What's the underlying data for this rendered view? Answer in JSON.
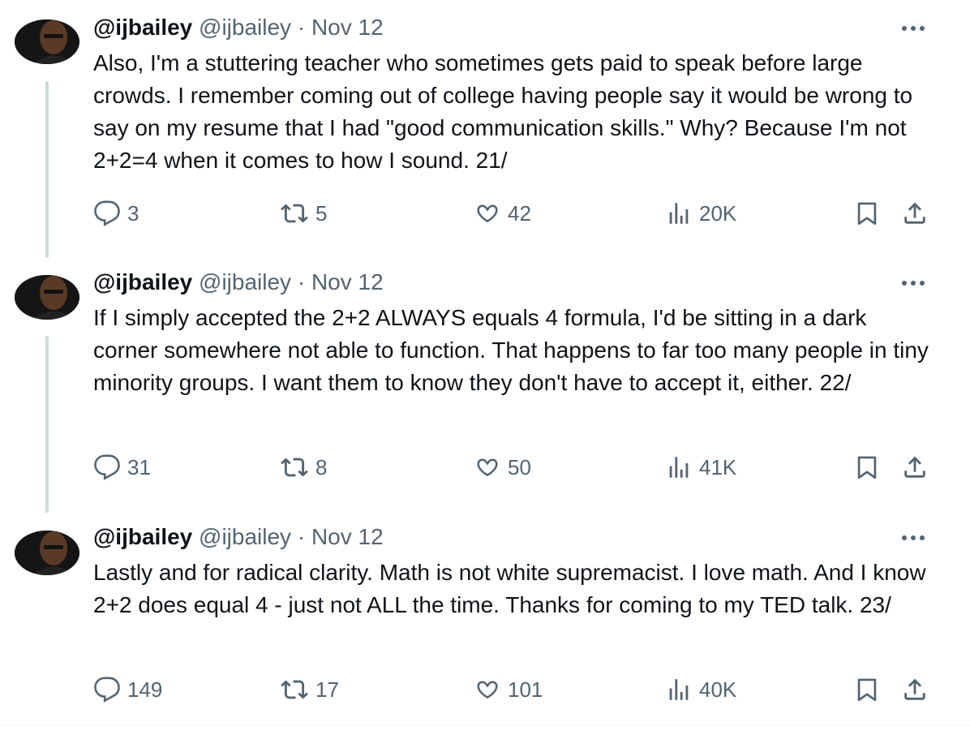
{
  "tweets": [
    {
      "name": "@ijbailey",
      "handle": "@ijbailey",
      "separator": "·",
      "date": "Nov 12",
      "text": "Also, I'm a stuttering teacher who sometimes gets paid to speak before large crowds. I remember coming out of college having people say it would be wrong to say on my resume that I had \"good communication skills.\" Why? Because I'm not 2+2=4 when it comes to how I sound. 21/",
      "replies": "3",
      "reposts": "5",
      "likes": "42",
      "views": "20K"
    },
    {
      "name": "@ijbailey",
      "handle": "@ijbailey",
      "separator": "·",
      "date": "Nov 12",
      "text": "If I simply accepted the 2+2 ALWAYS equals 4 formula, I'd be sitting in a dark corner somewhere not able to function. That happens to far too many people in tiny minority groups. I want them to know they don't have to accept it, either. 22/",
      "replies": "31",
      "reposts": "8",
      "likes": "50",
      "views": "41K"
    },
    {
      "name": "@ijbailey",
      "handle": "@ijbailey",
      "separator": "·",
      "date": "Nov 12",
      "text": "Lastly and for radical clarity. Math is not white supremacist. I love math. And I know 2+2 does equal 4 - just not ALL the time. Thanks for coming to my TED talk. 23/",
      "replies": "149",
      "reposts": "17",
      "likes": "101",
      "views": "40K"
    }
  ],
  "icons": {
    "more": "more-horizontal-icon",
    "reply": "speech-bubble-icon",
    "repost": "repost-arrows-icon",
    "like": "heart-icon",
    "views": "bar-chart-icon",
    "bookmark": "bookmark-icon",
    "share": "share-upload-icon"
  },
  "colors": {
    "text": "#0f1419",
    "secondary": "#536471",
    "thread_line": "#cfd9de"
  }
}
